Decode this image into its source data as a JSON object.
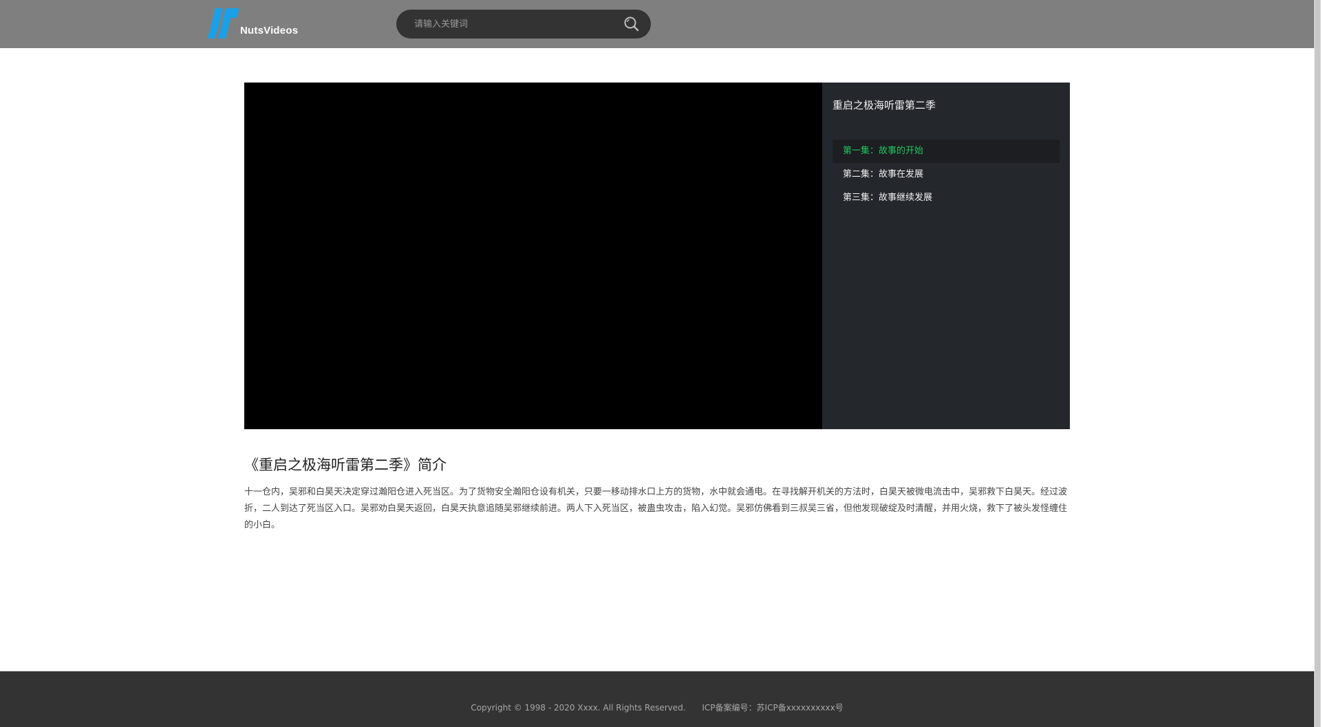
{
  "header": {
    "logo_text": "NutsVideos",
    "search_placeholder": "请输入关键词",
    "search_icon": "search-icon",
    "logo_color": "#1aa0e6"
  },
  "playlist": {
    "title": "重启之极海听雷第二季",
    "episodes": [
      {
        "label": "第一集：故事的开始",
        "active": true
      },
      {
        "label": "第二集：故事在发展",
        "active": false
      },
      {
        "label": "第三集：故事继续发展",
        "active": false
      }
    ],
    "active_color": "#22c55e"
  },
  "intro": {
    "title": "《重启之极海听雷第二季》简介",
    "text": "十一仓内，吴邪和白昊天决定穿过瀚阳仓进入死当区。为了货物安全瀚阳仓设有机关，只要一移动排水口上方的货物，水中就会通电。在寻找解开机关的方法时，白昊天被微电流击中，吴邪救下白昊天。经过波折，二人到达了死当区入口。吴邪劝白昊天返回，白昊天执意追随吴邪继续前进。两人下入死当区，被蛊虫攻击，陷入幻觉。吴邪仿佛看到三叔吴三省，但他发现破绽及时清醒，并用火烧，救下了被头发怪缠住的小白。"
  },
  "footer": {
    "copyright": "Copyright © 1998 - 2020 Xxxx. All Rights Reserved.",
    "icp": "ICP备案编号：苏ICP备xxxxxxxxxx号"
  }
}
